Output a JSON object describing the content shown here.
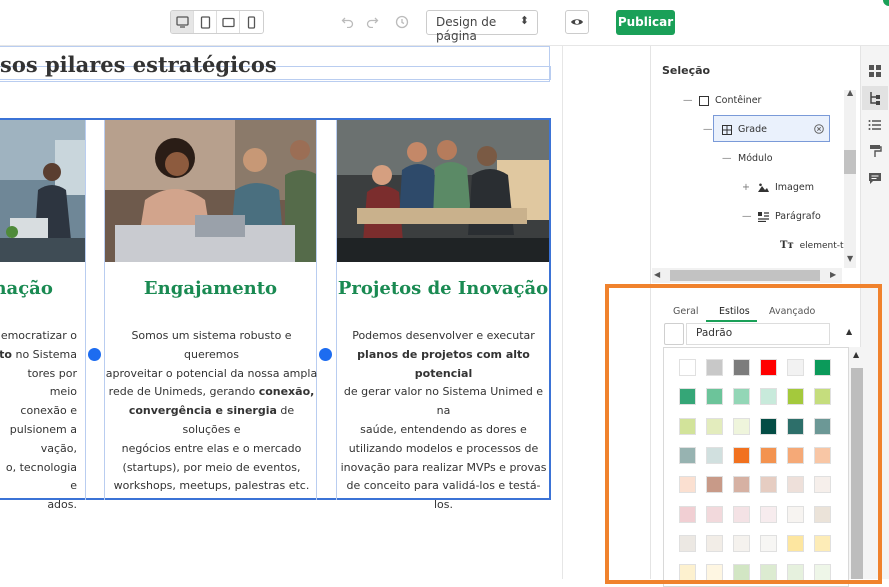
{
  "toolbar": {
    "devices": [
      "desktop-icon",
      "tablet-icon",
      "tablet-landscape-icon",
      "mobile-icon"
    ],
    "design_select": "Design de página",
    "publish": "Publicar"
  },
  "canvas": {
    "title": "sos pilares estratégicos",
    "columns": [
      {
        "heading": "rmação",
        "lines": [
          "emocratizar o",
          "<b>to</b> no Sistema",
          "tores por meio",
          "conexão e",
          "pulsionem a",
          "vação,",
          "o, tecnologia e",
          "ados."
        ]
      },
      {
        "heading": "Engajamento",
        "lines": [
          "Somos um sistema robusto e queremos",
          "aproveitar o potencial da nossa ampla",
          "rede de Unimeds, gerando <b>conexão,</b>",
          "<b>convergência e sinergia</b> de soluções e",
          "negócios entre elas e o mercado",
          "(startups), por meio de eventos,",
          "workshops, meetups, palestras etc."
        ]
      },
      {
        "heading": "Projetos de Inovação",
        "lines": [
          "Podemos desenvolver e executar",
          "<b>planos de projetos com alto potencial</b>",
          "de gerar valor no Sistema Unimed e na",
          "saúde, entendendo as dores e",
          "utilizando modelos e processos de",
          "inovação para realizar MVPs e provas",
          "de conceito para validá-los e testá-los."
        ]
      }
    ]
  },
  "panel": {
    "selection_title": "Seleção",
    "tree": {
      "container": "Contêiner",
      "grid": "Grade",
      "module": "Módulo",
      "image": "Imagem",
      "paragraph": "Parágrafo",
      "element_text": "element-tex"
    },
    "tabs": [
      "Geral",
      "Estilos",
      "Avançado"
    ],
    "active_tab": "Estilos",
    "style_select": "Padrão",
    "palette": [
      [
        "#ffffff",
        "#c8c8c8",
        "#7c7c7c",
        "#ff0000",
        "#f2f2f2",
        "#0b9a5a"
      ],
      [
        "#35a677",
        "#6cc49a",
        "#93d6b6",
        "#c8eadb",
        "#a4c93c",
        "#c5dd7d"
      ],
      [
        "#d2e39a",
        "#e3ecbd",
        "#eff5dc",
        "#044d45",
        "#2d6f6a",
        "#6c9896"
      ],
      [
        "#97b3b1",
        "#d1e0df",
        "#f1711f",
        "#f39350",
        "#f5a977",
        "#f8c6a5"
      ],
      [
        "#fbe0d1",
        "#c89a88",
        "#d6b1a3",
        "#e6cdc2",
        "#eee0da",
        "#f6efeb"
      ],
      [
        "#f1cfd3",
        "#f2d9dc",
        "#f4e2e5",
        "#f7ecee",
        "#f7f4f1",
        "#ebe3d9"
      ],
      [
        "#ece8e3",
        "#f2ede7",
        "#f5f2ee",
        "#f7f6f4",
        "#fde6a0",
        "#fdecb7"
      ],
      [
        "#fdf1cf",
        "#fef6e2",
        "#d2e6c4",
        "#dcebd1",
        "#e6f1de",
        "#eef6e8"
      ]
    ]
  }
}
